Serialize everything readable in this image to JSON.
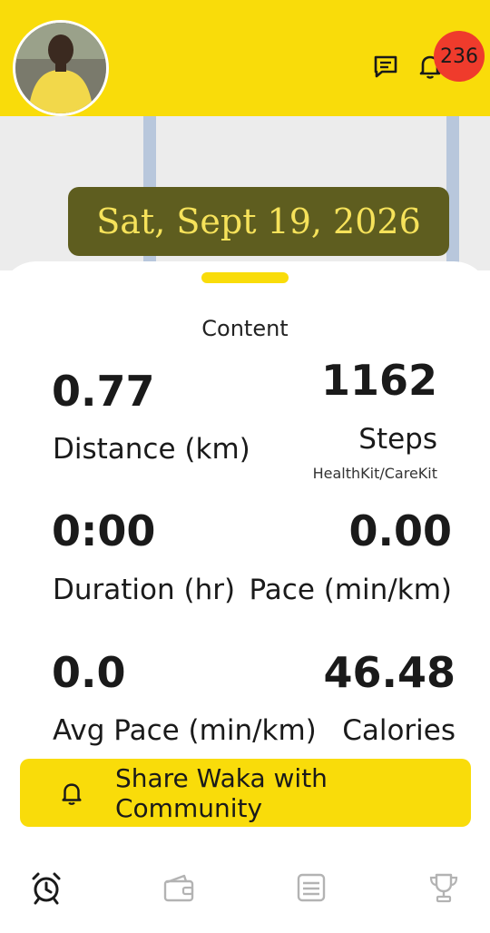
{
  "header": {
    "badge_count": "236"
  },
  "date": "Sat, Sept 19, 2026",
  "sheet": {
    "content_label": "Content",
    "metrics": {
      "distance": {
        "value": "0.77",
        "label": "Distance (km)"
      },
      "steps": {
        "value": "1162",
        "label": "Steps",
        "source": "HealthKit/CareKit"
      },
      "duration": {
        "value": "0:00",
        "label": "Duration (hr)"
      },
      "pace": {
        "value": "0.00",
        "label": "Pace (min/km)"
      },
      "avg_pace": {
        "value": "0.0",
        "label": "Avg Pace (min/km)"
      },
      "calories": {
        "value": "46.48",
        "label": "Calories"
      }
    }
  },
  "share_button": {
    "label": "Share Waka with Community"
  },
  "nav": {
    "items": [
      {
        "icon": "alarm-clock-icon"
      },
      {
        "icon": "wallet-icon"
      },
      {
        "icon": "list-icon"
      },
      {
        "icon": "trophy-icon"
      }
    ]
  },
  "colors": {
    "brand_yellow": "#f9dc0a",
    "date_pill": "#5e5d1f",
    "date_text": "#f6e25a",
    "badge_red": "#ef3b2c"
  }
}
